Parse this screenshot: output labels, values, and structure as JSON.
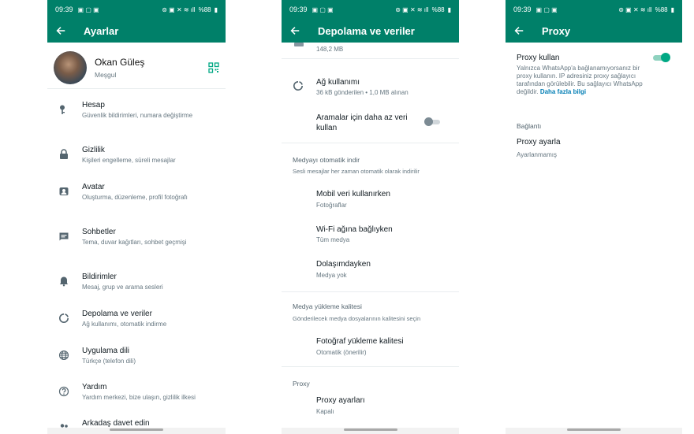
{
  "status": {
    "time": "09:39",
    "battery": "%88"
  },
  "settings": {
    "title": "Ayarlar",
    "profile": {
      "name": "Okan Güleş",
      "status": "Meşgul"
    },
    "items": [
      {
        "title": "Hesap",
        "desc": "Güvenlik bildirimleri, numara değiştirme",
        "icon": "key-icon"
      },
      {
        "title": "Gizlilik",
        "desc": "Kişileri engelleme, süreli mesajlar",
        "icon": "lock-icon"
      },
      {
        "title": "Avatar",
        "desc": "Oluşturma, düzenleme, profil fotoğrafı",
        "icon": "avatar-icon"
      },
      {
        "title": "Sohbetler",
        "desc": "Tema, duvar kağıtları, sohbet geçmişi",
        "icon": "chat-icon"
      },
      {
        "title": "Bildirimler",
        "desc": "Mesaj, grup ve arama sesleri",
        "icon": "bell-icon"
      },
      {
        "title": "Depolama ve veriler",
        "desc": "Ağ kullanımı, otomatik indirme",
        "icon": "storage-icon"
      },
      {
        "title": "Uygulama dili",
        "desc": "Türkçe (telefon dili)",
        "icon": "globe-icon"
      },
      {
        "title": "Yardım",
        "desc": "Yardım merkezi, bize ulaşın, gizlilik ilkesi",
        "icon": "help-icon"
      },
      {
        "title": "Arkadaş davet edin",
        "desc": "",
        "icon": "people-icon"
      }
    ]
  },
  "storage": {
    "title": "Depolama ve veriler",
    "top_size": "148,2 MB",
    "network": {
      "title": "Ağ kullanımı",
      "desc": "36 kB gönderilen • 1,0 MB alınan"
    },
    "less_data": {
      "title": "Aramalar için daha az veri kullan",
      "enabled": false
    },
    "auto_download": {
      "header": "Medyayı otomatik indir",
      "sub": "Sesli mesajlar her zaman otomatik olarak indirilir",
      "items": [
        {
          "title": "Mobil veri kullanırken",
          "desc": "Fotoğraflar"
        },
        {
          "title": "Wi-Fi ağına bağlıyken",
          "desc": "Tüm medya"
        },
        {
          "title": "Dolaşımdayken",
          "desc": "Medya yok"
        }
      ]
    },
    "upload_quality": {
      "header": "Medya yükleme kalitesi",
      "sub": "Gönderilecek medya dosyalarının kalitesini seçin",
      "item": {
        "title": "Fotoğraf yükleme kalitesi",
        "desc": "Otomatik (önerilir)"
      }
    },
    "proxy": {
      "header": "Proxy",
      "title": "Proxy ayarları",
      "desc": "Kapalı"
    }
  },
  "proxy": {
    "title": "Proxy",
    "use_proxy": {
      "label": "Proxy kullan",
      "enabled": true
    },
    "desc": "Yalnızca WhatsApp'a bağlanamıyorsanız bir proxy kullanın. IP adresiniz proxy sağlayıcı tarafından görülebilir. Bu sağlayıcı WhatsApp değildir.",
    "link": "Daha fazla bilgi",
    "connection_label": "Bağlantı",
    "set_proxy": {
      "title": "Proxy ayarla",
      "desc": "Ayarlanmamış"
    }
  },
  "colors": {
    "primary": "#008069",
    "accent": "#00a884",
    "link": "#027eb5"
  }
}
